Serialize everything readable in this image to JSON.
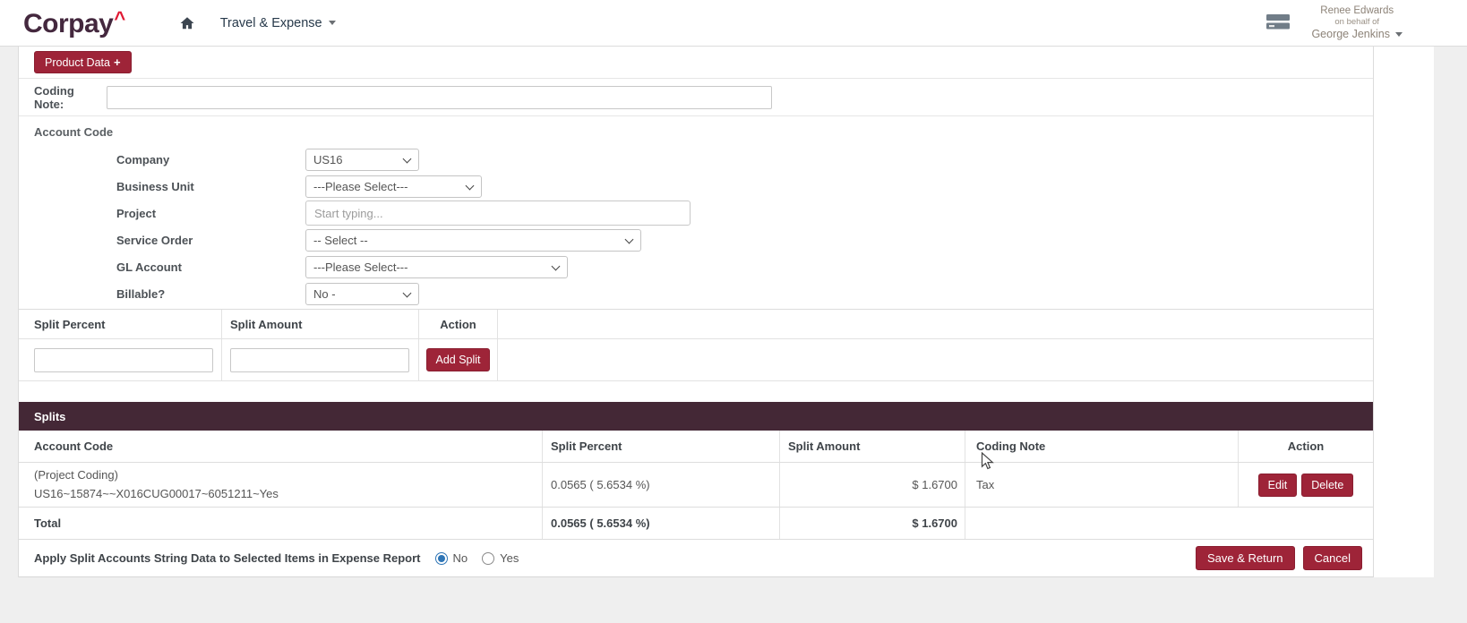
{
  "navbar": {
    "brand": "Corpay",
    "brand_caret": "^",
    "nav_item": "Travel & Expense",
    "user": {
      "name": "Renee Edwards",
      "on_behalf": "on behalf of",
      "acting_as": "George Jenkins"
    }
  },
  "toolbar": {
    "product_data_label": "Product Data",
    "product_data_plus": "+"
  },
  "coding_note": {
    "label": "Coding Note:",
    "value": ""
  },
  "account_code": {
    "heading": "Account Code",
    "company": {
      "label": "Company",
      "value": "US16"
    },
    "business_unit": {
      "label": "Business Unit",
      "value": "---Please Select---"
    },
    "project": {
      "label": "Project",
      "placeholder": "Start typing...",
      "value": ""
    },
    "service_order": {
      "label": "Service Order",
      "value": "-- Select --"
    },
    "gl_account": {
      "label": "GL Account",
      "value": "---Please Select---"
    },
    "billable": {
      "label": "Billable?",
      "value": "No -"
    }
  },
  "split_entry": {
    "col_split_percent": "Split Percent",
    "col_split_amount": "Split Amount",
    "col_action": "Action",
    "percent_value": "",
    "amount_value": "",
    "add_split_label": "Add Split"
  },
  "splits": {
    "title": "Splits",
    "col_account_code": "Account Code",
    "col_split_percent": "Split Percent",
    "col_split_amount": "Split Amount",
    "col_coding_note": "Coding Note",
    "col_action": "Action",
    "rows": [
      {
        "account_line1": "(Project Coding)",
        "account_line2": "US16~15874~~X016CUG00017~6051211~Yes",
        "split_percent": "0.0565 ( 5.6534 %)",
        "split_amount": "$ 1.6700",
        "coding_note": "Tax",
        "edit_label": "Edit",
        "delete_label": "Delete"
      }
    ],
    "total_label": "Total",
    "total_split_percent": "0.0565 ( 5.6534 %)",
    "total_split_amount": "$ 1.6700"
  },
  "footer": {
    "apply_label": "Apply Split Accounts String Data to Selected Items in Expense Report",
    "option_no": "No",
    "option_yes": "Yes",
    "selected_option": "No",
    "save_label": "Save & Return",
    "cancel_label": "Cancel"
  },
  "colors": {
    "accent_maroon": "#9e2438",
    "splits_header_bg": "#442836",
    "brand_caret_red": "#e01933",
    "radio_selected_blue": "#2e75b6"
  }
}
